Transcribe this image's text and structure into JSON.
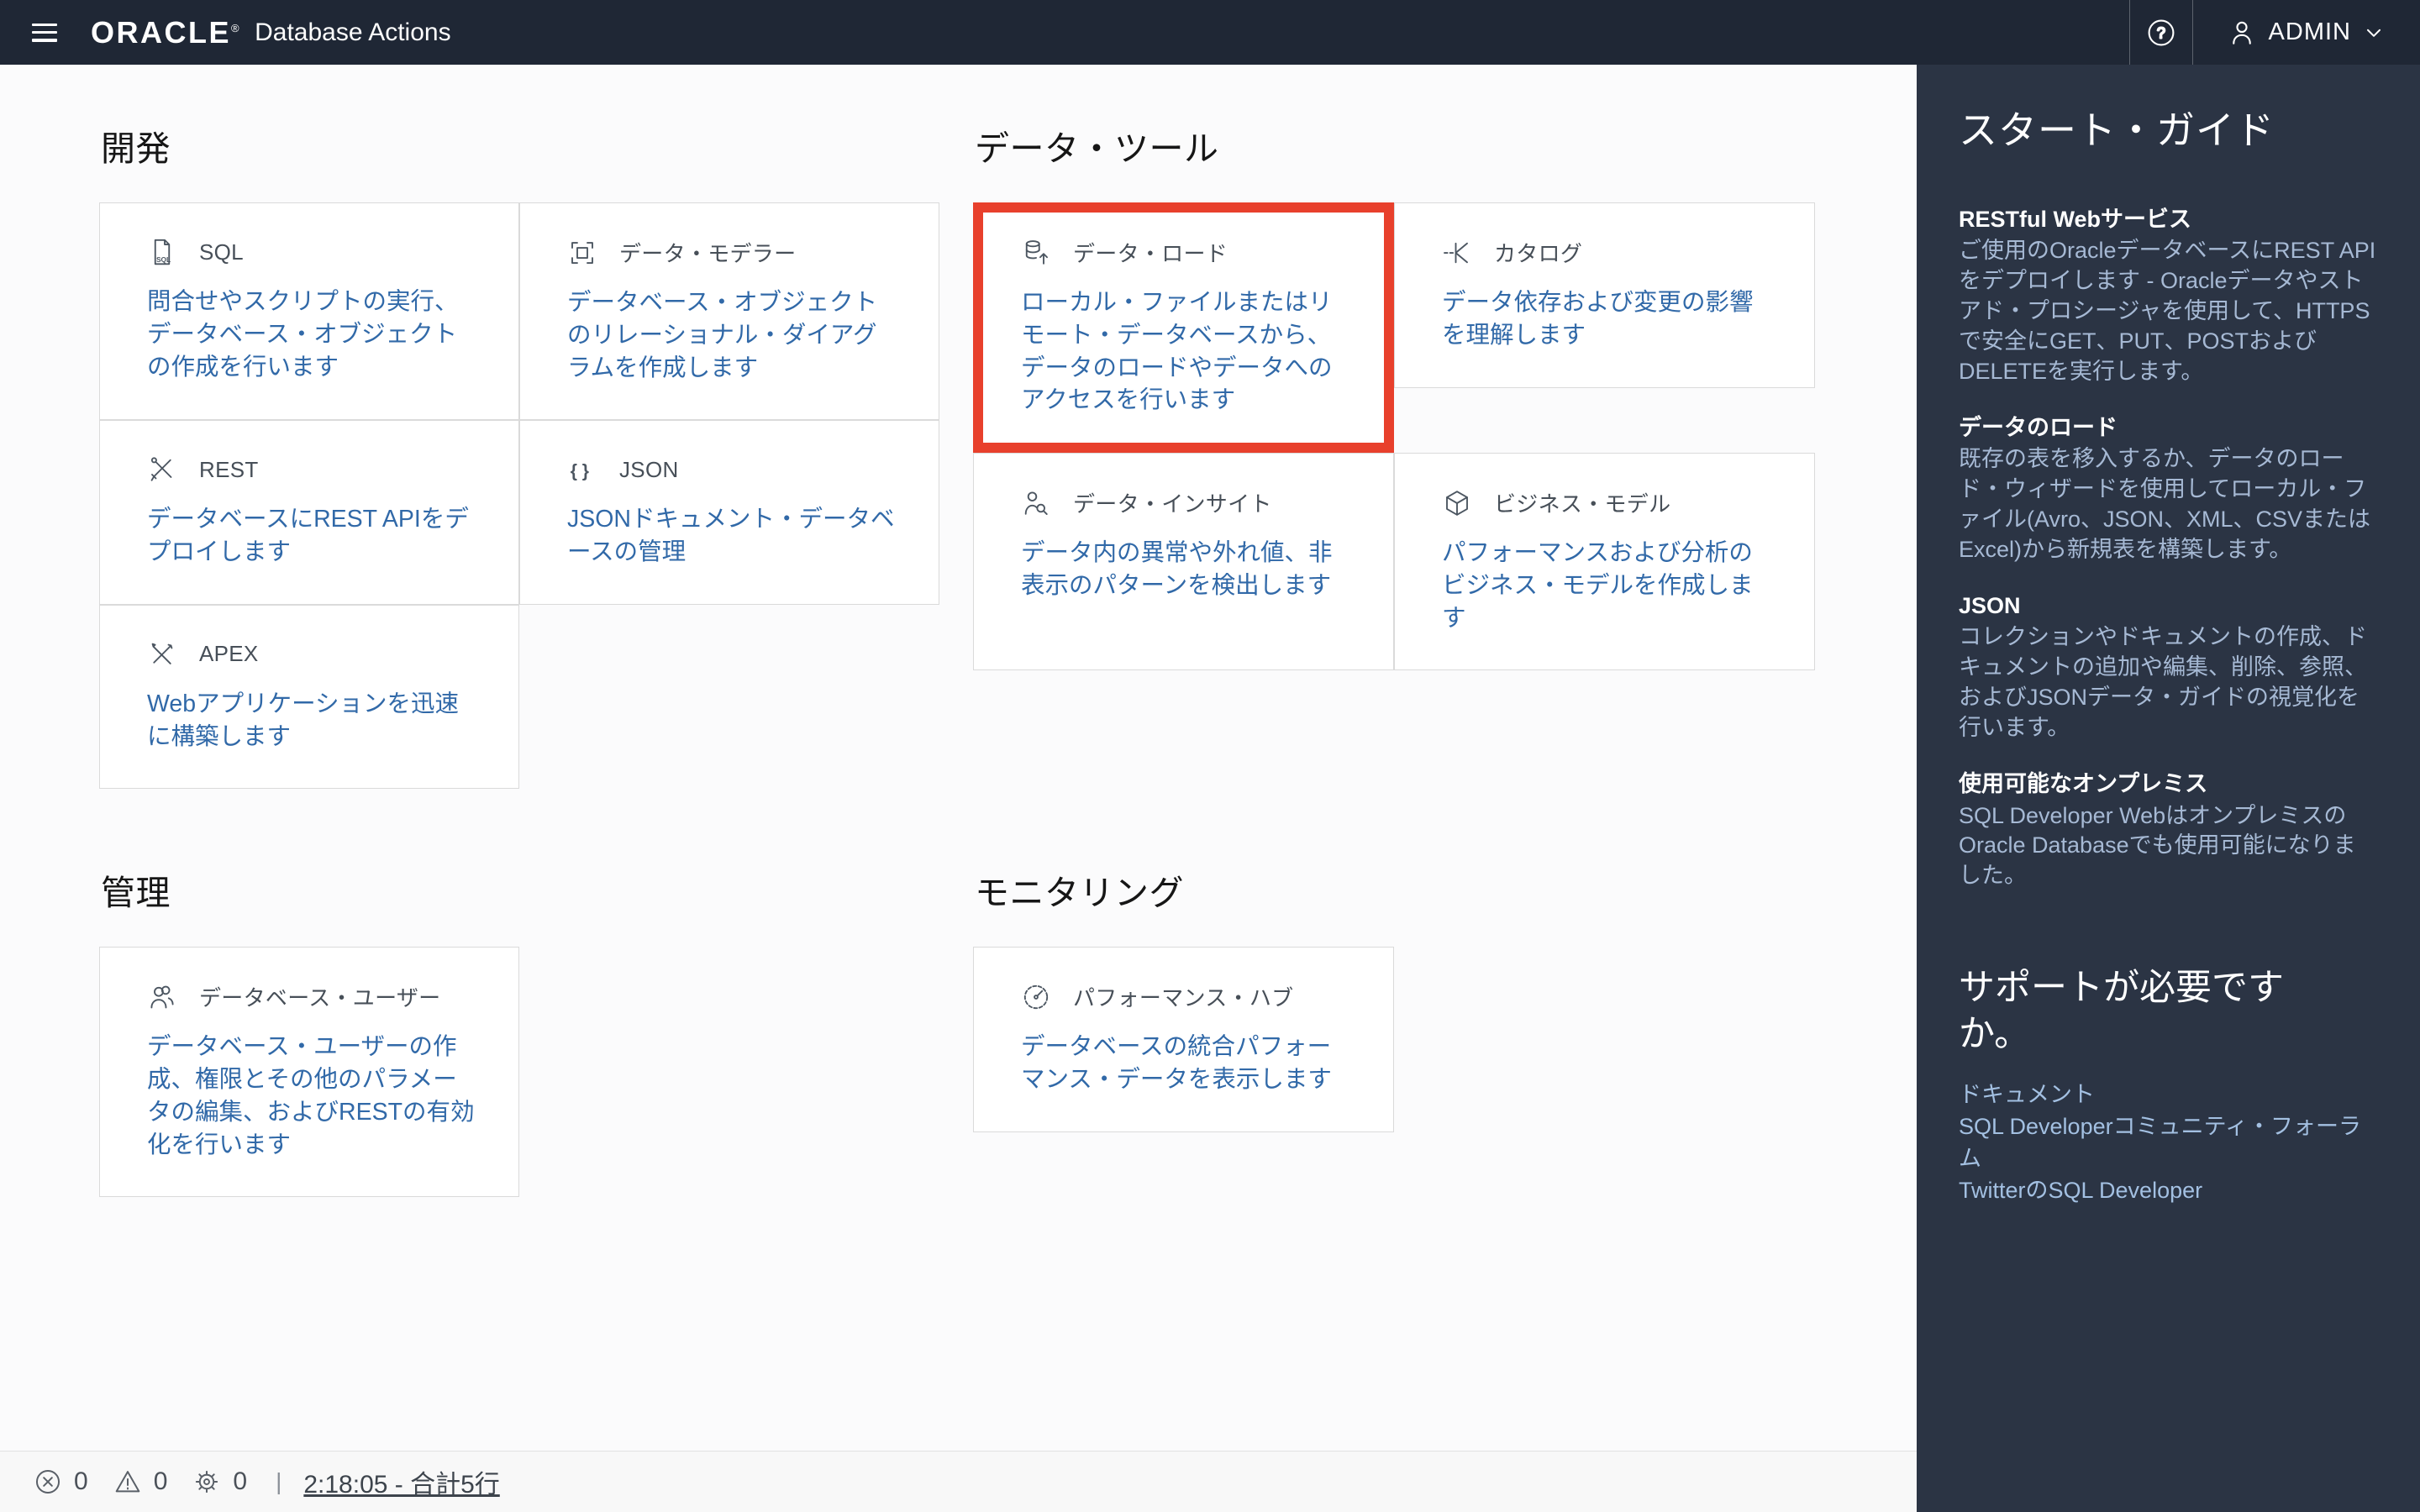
{
  "topbar": {
    "brand": "ORACLE",
    "brand_registered": "®",
    "product": "Database Actions",
    "user": "ADMIN",
    "help_glyph": "?"
  },
  "icons": {
    "sql_text": "SQL",
    "json_glyph": "{ }"
  },
  "colors": {
    "topbar_bg": "#1f2735",
    "sidebar_bg": "#2b3444",
    "link_blue": "#3169a8",
    "highlight_red": "#e8402c"
  },
  "sections": [
    {
      "title": "開発",
      "cards": [
        {
          "label": "SQL",
          "desc": "問合せやスクリプトの実行、データベース・オブジェクトの作成を行います"
        },
        {
          "label": "データ・モデラー",
          "desc": "データベース・オブジェクトのリレーショナル・ダイアグラムを作成します"
        },
        {
          "label": "REST",
          "desc": "データベースにREST APIをデプロイします"
        },
        {
          "label": "JSON",
          "desc": "JSONドキュメント・データベースの管理"
        },
        {
          "label": "APEX",
          "desc": "Webアプリケーションを迅速に構築します"
        }
      ]
    },
    {
      "title": "データ・ツール",
      "cards": [
        {
          "label": "データ・ロード",
          "desc": "ローカル・ファイルまたはリモート・データベースから、データのロードやデータへのアクセスを行います",
          "highlighted": true
        },
        {
          "label": "カタログ",
          "desc": "データ依存および変更の影響を理解します"
        },
        {
          "label": "データ・インサイト",
          "desc": "データ内の異常や外れ値、非表示のパターンを検出します"
        },
        {
          "label": "ビジネス・モデル",
          "desc": "パフォーマンスおよび分析のビジネス・モデルを作成します"
        }
      ]
    },
    {
      "title": "管理",
      "cards": [
        {
          "label": "データベース・ユーザー",
          "desc": "データベース・ユーザーの作成、権限とその他のパラメータの編集、およびRESTの有効化を行います"
        }
      ]
    },
    {
      "title": "モニタリング",
      "cards": [
        {
          "label": "パフォーマンス・ハブ",
          "desc": "データベースの統合パフォーマンス・データを表示します"
        }
      ]
    }
  ],
  "sidebar": {
    "title": "スタート・ガイド",
    "sections": [
      {
        "heading": "RESTful Webサービス",
        "body": "ご使用のOracleデータベースにREST APIをデプロイします - Oracleデータやストアド・プロシージャを使用して、HTTPSで安全にGET、PUT、POSTおよびDELETEを実行します。"
      },
      {
        "heading": "データのロード",
        "body": "既存の表を移入するか、データのロード・ウィザードを使用してローカル・ファイル(Avro、JSON、XML、CSVまたはExcel)から新規表を構築します。"
      },
      {
        "heading": "JSON",
        "body": "コレクションやドキュメントの作成、ドキュメントの追加や編集、削除、参照、およびJSONデータ・ガイドの視覚化を行います。"
      },
      {
        "heading": "使用可能なオンプレミス",
        "body": "SQL Developer WebはオンプレミスのOracle Databaseでも使用可能になりました。"
      }
    ],
    "support": {
      "title": "サポートが必要ですか。",
      "links": [
        "ドキュメント",
        "SQL Developerコミュニティ・フォーラム",
        "TwitterのSQL Developer"
      ]
    }
  },
  "statusbar": {
    "error_count": "0",
    "warning_count": "0",
    "process_count": "0",
    "separator": "|",
    "time_link": "2:18:05 - 合計5行"
  }
}
